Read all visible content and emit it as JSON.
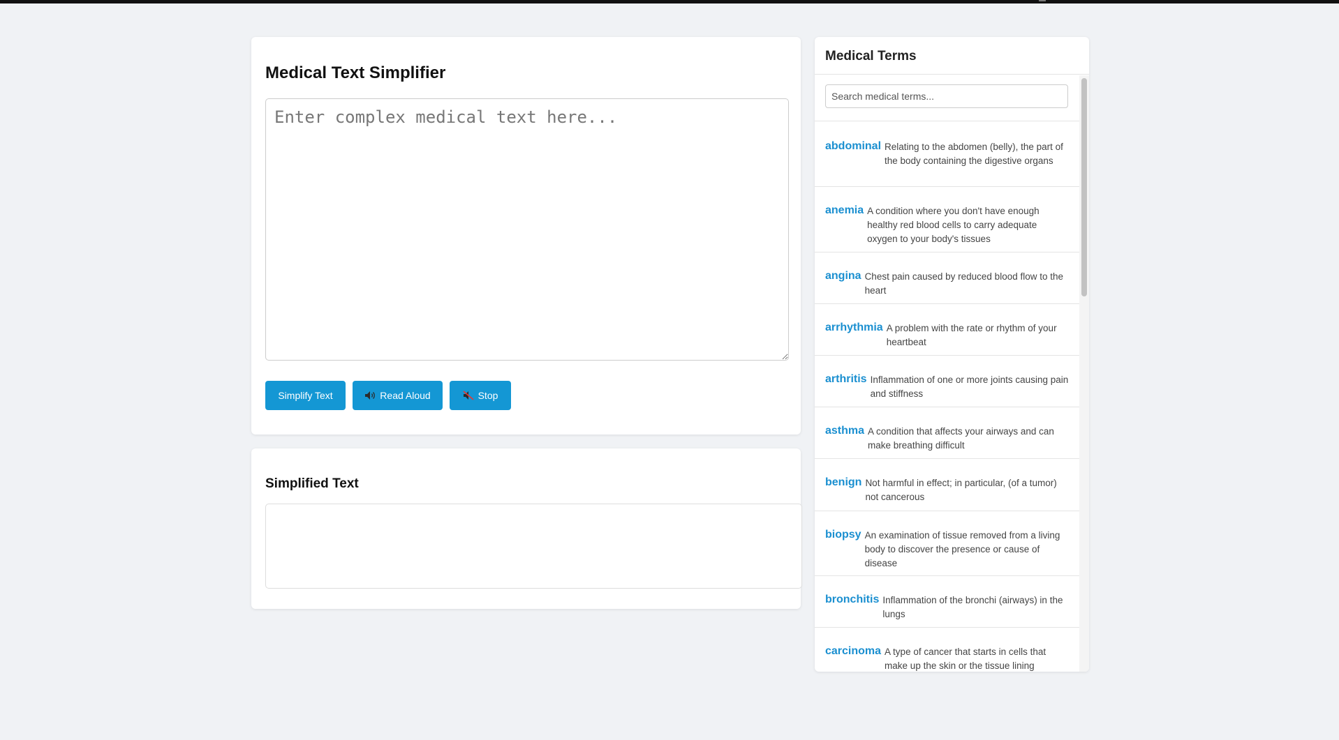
{
  "main": {
    "title": "Medical Text Simplifier",
    "input_placeholder": "Enter complex medical text here...",
    "input_value": "",
    "buttons": {
      "simplify": "Simplify Text",
      "read_aloud": "Read Aloud",
      "read_aloud_icon": "speaker-icon",
      "stop": "Stop",
      "stop_icon": "speaker-muted-icon"
    },
    "accent_color": "#1497d4"
  },
  "result": {
    "title": "Simplified Text",
    "value": ""
  },
  "terms": {
    "title": "Medical Terms",
    "search_placeholder": "Search medical terms...",
    "term_color": "#1a8fd0",
    "items": [
      {
        "term": "abdominal",
        "definition": "Relating to the abdomen (belly), the part of the body containing the digestive organs"
      },
      {
        "term": "anemia",
        "definition": "A condition where you don't have enough healthy red blood cells to carry adequate oxygen to your body's tissues"
      },
      {
        "term": "angina",
        "definition": "Chest pain caused by reduced blood flow to the heart"
      },
      {
        "term": "arrhythmia",
        "definition": "A problem with the rate or rhythm of your heartbeat"
      },
      {
        "term": "arthritis",
        "definition": "Inflammation of one or more joints causing pain and stiffness"
      },
      {
        "term": "asthma",
        "definition": "A condition that affects your airways and can make breathing difficult"
      },
      {
        "term": "benign",
        "definition": "Not harmful in effect; in particular, (of a tumor) not cancerous"
      },
      {
        "term": "biopsy",
        "definition": "An examination of tissue removed from a living body to discover the presence or cause of disease"
      },
      {
        "term": "bronchitis",
        "definition": "Inflammation of the bronchi (airways) in the lungs"
      },
      {
        "term": "carcinoma",
        "definition": "A type of cancer that starts in cells that make up the skin or the tissue lining"
      }
    ]
  }
}
